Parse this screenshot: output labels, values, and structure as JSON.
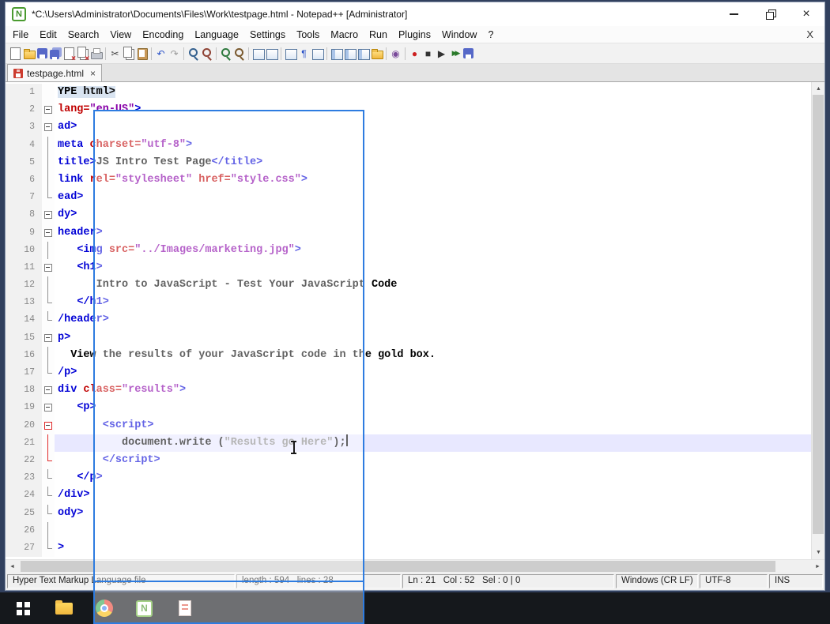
{
  "app": "Notepad++",
  "window": {
    "title": "*C:\\Users\\Administrator\\Documents\\Files\\Work\\testpage.html - Notepad++ [Administrator]",
    "app_icon_letter": "N",
    "controls": {
      "close": "×"
    }
  },
  "menu": {
    "items": [
      "File",
      "Edit",
      "Search",
      "View",
      "Encoding",
      "Language",
      "Settings",
      "Tools",
      "Macro",
      "Run",
      "Plugins",
      "Window",
      "?"
    ],
    "right_close": "X"
  },
  "toolbar": {
    "icons": [
      {
        "name": "new-file-icon",
        "k": "page"
      },
      {
        "name": "open-file-icon",
        "k": "folder"
      },
      {
        "name": "save-icon",
        "k": "floppy"
      },
      {
        "name": "save-all-icon",
        "k": "floppy2"
      },
      {
        "name": "close-icon",
        "k": "pagex"
      },
      {
        "name": "close-all-icon",
        "k": "pagex2"
      },
      {
        "name": "print-icon",
        "k": "printer"
      },
      {
        "k": "sep"
      },
      {
        "name": "cut-icon",
        "k": "char",
        "g": "✂",
        "c": "#444444"
      },
      {
        "name": "copy-icon",
        "k": "pages"
      },
      {
        "name": "paste-icon",
        "k": "clipboard"
      },
      {
        "k": "sep"
      },
      {
        "name": "undo-icon",
        "k": "char",
        "g": "↶",
        "c": "#2a52c8"
      },
      {
        "name": "redo-icon",
        "k": "char",
        "g": "↷",
        "c": "#9a9a9a"
      },
      {
        "k": "sep"
      },
      {
        "name": "find-icon",
        "k": "mag"
      },
      {
        "name": "replace-icon",
        "k": "magr"
      },
      {
        "k": "sep"
      },
      {
        "name": "zoom-in-icon",
        "k": "magp"
      },
      {
        "name": "zoom-out-icon",
        "k": "magm"
      },
      {
        "k": "sep"
      },
      {
        "name": "sync-vertical-scroll-icon",
        "k": "panel"
      },
      {
        "name": "sync-horizontal-scroll-icon",
        "k": "panel"
      },
      {
        "k": "sep"
      },
      {
        "name": "word-wrap-icon",
        "k": "panel"
      },
      {
        "name": "show-all-characters-icon",
        "k": "char",
        "g": "¶",
        "c": "#2a52c8"
      },
      {
        "name": "indent-guide-icon",
        "k": "panel"
      },
      {
        "k": "sep"
      },
      {
        "name": "function-list-icon",
        "k": "panel2"
      },
      {
        "name": "document-map-icon",
        "k": "panel2"
      },
      {
        "name": "document-list-icon",
        "k": "panel2"
      },
      {
        "name": "folder-as-workspace-icon",
        "k": "folder"
      },
      {
        "k": "sep"
      },
      {
        "name": "file-monitoring-icon",
        "k": "char",
        "g": "◉",
        "c": "#7a4a9a"
      },
      {
        "k": "sep"
      },
      {
        "name": "record-macro-icon",
        "k": "char",
        "g": "●",
        "c": "#cc2020"
      },
      {
        "name": "stop-macro-icon",
        "k": "char",
        "g": "■",
        "c": "#333333"
      },
      {
        "name": "play-macro-icon",
        "k": "char",
        "g": "▶",
        "c": "#333333"
      },
      {
        "name": "run-macro-multiple-icon",
        "k": "char2",
        "g": "▶▶",
        "c": "#2a7a2a"
      },
      {
        "name": "save-macro-icon",
        "k": "floppy"
      }
    ]
  },
  "tabs": [
    {
      "label": "testpage.html",
      "modified": true,
      "close_glyph": "×"
    }
  ],
  "editor": {
    "current_line": 21,
    "caret_line": 21,
    "lines": [
      {
        "n": 1,
        "m": "",
        "seg": [
          [
            "doctype",
            "YPE html>"
          ]
        ]
      },
      {
        "n": 2,
        "m": "box",
        "seg": [
          [
            "attr",
            "lang="
          ],
          [
            "str",
            "\"en-US\""
          ],
          [
            "tag",
            ">"
          ]
        ]
      },
      {
        "n": 3,
        "m": "box",
        "seg": [
          [
            "tag",
            "ad>"
          ]
        ]
      },
      {
        "n": 4,
        "m": "v",
        "seg": [
          [
            "tag",
            "meta "
          ],
          [
            "attr",
            "charset="
          ],
          [
            "str",
            "\"utf-8\""
          ],
          [
            "tag",
            ">"
          ]
        ]
      },
      {
        "n": 5,
        "m": "v",
        "seg": [
          [
            "tag",
            "title>"
          ],
          [
            "txt",
            "JS Intro Test Page"
          ],
          [
            "tag",
            "</title>"
          ]
        ]
      },
      {
        "n": 6,
        "m": "v",
        "seg": [
          [
            "tag",
            "link "
          ],
          [
            "attr",
            "rel="
          ],
          [
            "str",
            "\"stylesheet\""
          ],
          [
            "attr",
            " href="
          ],
          [
            "str",
            "\"style.css\""
          ],
          [
            "tag",
            ">"
          ]
        ]
      },
      {
        "n": 7,
        "m": "corner",
        "seg": [
          [
            "tag",
            "ead>"
          ]
        ]
      },
      {
        "n": 8,
        "m": "box",
        "seg": [
          [
            "tag",
            "dy>"
          ]
        ]
      },
      {
        "n": 9,
        "m": "box",
        "seg": [
          [
            "tag",
            "header>"
          ]
        ]
      },
      {
        "n": 10,
        "m": "v",
        "seg": [
          [
            "plain",
            "   "
          ],
          [
            "tag",
            "<img "
          ],
          [
            "attr",
            "src="
          ],
          [
            "str",
            "\"../Images/marketing.jpg\""
          ],
          [
            "tag",
            ">"
          ]
        ]
      },
      {
        "n": 11,
        "m": "box",
        "seg": [
          [
            "plain",
            "   "
          ],
          [
            "tag",
            "<h1>"
          ]
        ]
      },
      {
        "n": 12,
        "m": "v",
        "seg": [
          [
            "txt",
            "      Intro to JavaScript - Test Your JavaScript Code"
          ]
        ]
      },
      {
        "n": 13,
        "m": "corner",
        "seg": [
          [
            "plain",
            "   "
          ],
          [
            "tag",
            "</h1>"
          ]
        ]
      },
      {
        "n": 14,
        "m": "corner",
        "seg": [
          [
            "tag",
            "/header>"
          ]
        ]
      },
      {
        "n": 15,
        "m": "box",
        "seg": [
          [
            "tag",
            "p>"
          ]
        ]
      },
      {
        "n": 16,
        "m": "v",
        "seg": [
          [
            "txt",
            "  View the results of your JavaScript code in the gold box."
          ]
        ]
      },
      {
        "n": 17,
        "m": "corner",
        "seg": [
          [
            "tag",
            "/p>"
          ]
        ]
      },
      {
        "n": 18,
        "m": "box",
        "seg": [
          [
            "tag",
            "div "
          ],
          [
            "attr",
            "class="
          ],
          [
            "str",
            "\"results\""
          ],
          [
            "tag",
            ">"
          ]
        ]
      },
      {
        "n": 19,
        "m": "box",
        "seg": [
          [
            "plain",
            "   "
          ],
          [
            "tag",
            "<p>"
          ]
        ]
      },
      {
        "n": 20,
        "m": "boxr",
        "seg": [
          [
            "plain",
            "       "
          ],
          [
            "tag",
            "<script>"
          ]
        ]
      },
      {
        "n": 21,
        "m": "vr",
        "seg": [
          [
            "plain",
            "          "
          ],
          [
            "js",
            "document.write ("
          ],
          [
            "jsstr",
            "\"Results go Here\""
          ],
          [
            "js",
            ");"
          ]
        ]
      },
      {
        "n": 22,
        "m": "cornerr",
        "seg": [
          [
            "plain",
            "       "
          ],
          [
            "tag",
            "</script>"
          ]
        ]
      },
      {
        "n": 23,
        "m": "corner",
        "seg": [
          [
            "plain",
            "   "
          ],
          [
            "tag",
            "</p>"
          ]
        ]
      },
      {
        "n": 24,
        "m": "corner",
        "seg": [
          [
            "tag",
            "/div>"
          ]
        ]
      },
      {
        "n": 25,
        "m": "corner",
        "seg": [
          [
            "tag",
            "ody>"
          ]
        ]
      },
      {
        "n": 26,
        "m": "v",
        "seg": []
      },
      {
        "n": 27,
        "m": "corner",
        "seg": [
          [
            "tag",
            ">"
          ]
        ]
      }
    ]
  },
  "scrollbars": {
    "up": "▲",
    "down": "▼",
    "left": "◄",
    "right": "►"
  },
  "status_bar": {
    "doc_type": "Hyper Text Markup Language file",
    "length_info": "length : 594   lines : 28",
    "position_info": "Ln : 21   Col : 52   Sel : 0 | 0",
    "eol": "Windows (CR LF)",
    "encoding": "UTF-8",
    "mode": "INS"
  },
  "taskbar": {
    "icons": [
      {
        "name": "start-button",
        "k": "win"
      },
      {
        "name": "file-explorer",
        "k": "folder"
      },
      {
        "name": "chrome-browser",
        "k": "chrome"
      },
      {
        "name": "notepad-plus-plus",
        "k": "npp",
        "active": true
      },
      {
        "name": "document-app",
        "k": "doc"
      }
    ]
  },
  "overlay": {
    "type": "screen-capture-selection-rectangle",
    "border_color": "#2e7ce0"
  },
  "colors": {
    "selection_border": "#2e7ce0",
    "current_line_bg": "#e8e8ff",
    "tag": "#0202d6",
    "attribute": "#c00000",
    "string": "#8800a8",
    "js_string": "#8a8a8a",
    "taskbar_bg": "#15181c"
  }
}
